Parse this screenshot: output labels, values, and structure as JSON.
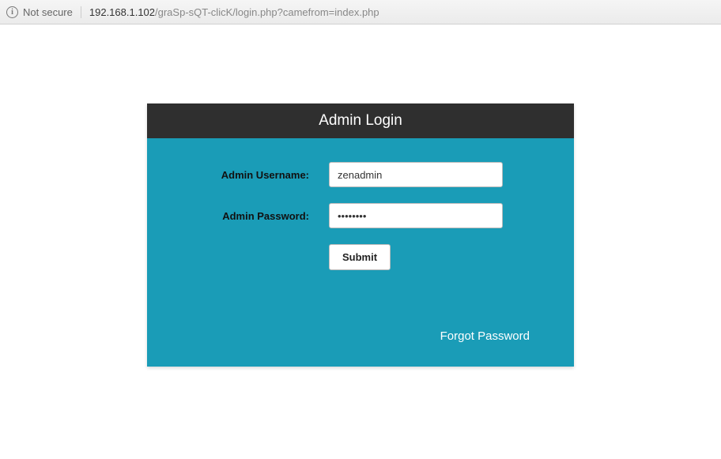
{
  "browser": {
    "security_label": "Not secure",
    "url_domain": "192.168.1.102",
    "url_path": "/graSp-sQT-clicK/login.php?camefrom=index.php"
  },
  "login": {
    "header_title": "Admin Login",
    "username_label": "Admin Username:",
    "username_value": "zenadmin",
    "password_label": "Admin Password:",
    "password_value": "password",
    "submit_label": "Submit",
    "forgot_label": "Forgot Password"
  }
}
